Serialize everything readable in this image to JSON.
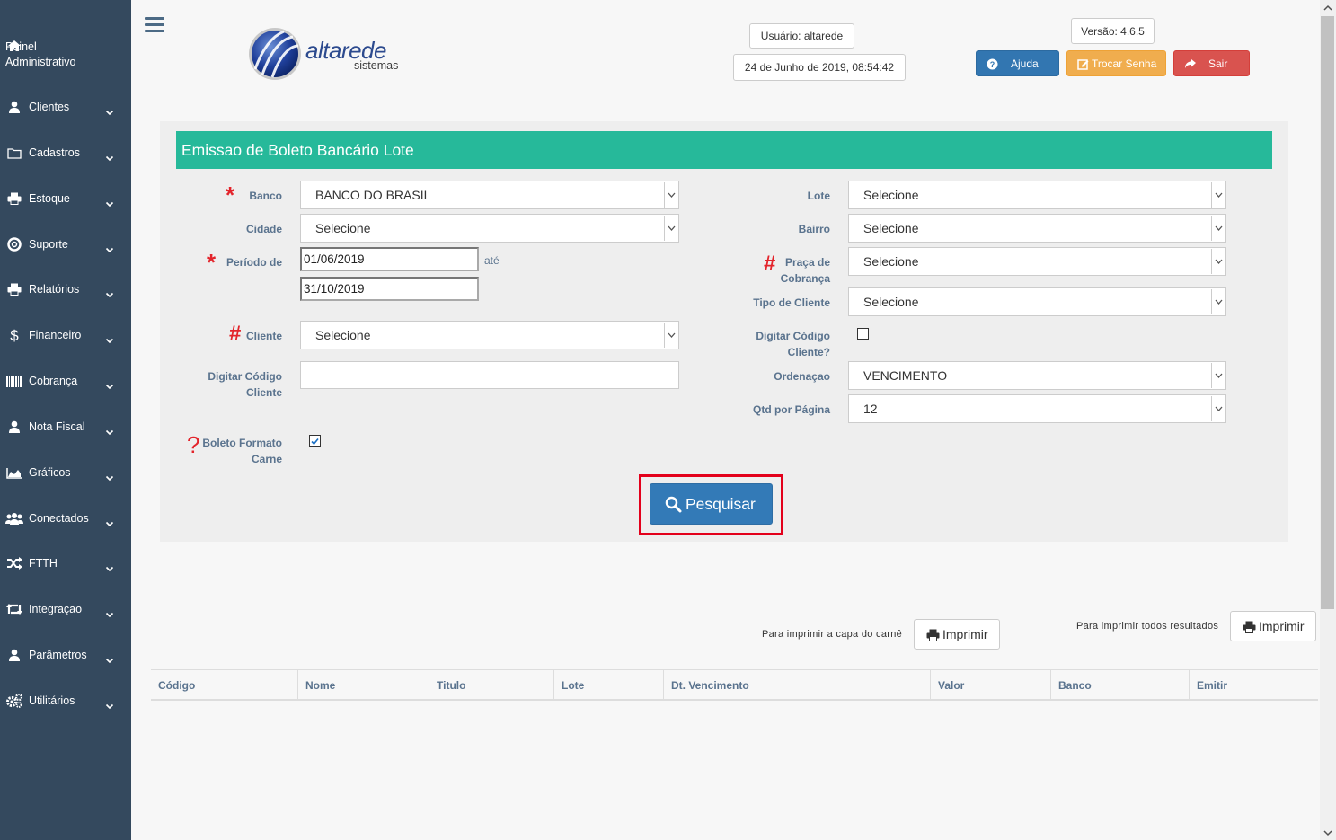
{
  "sidebar": {
    "items": [
      {
        "label": "Painel\nAdministrativo",
        "icon": "home-icon"
      },
      {
        "label": "Clientes",
        "icon": "user-icon"
      },
      {
        "label": "Cadastros",
        "icon": "folder-icon"
      },
      {
        "label": "Estoque",
        "icon": "print-icon"
      },
      {
        "label": "Suporte",
        "icon": "lifebuoy-icon"
      },
      {
        "label": "Relatórios",
        "icon": "print-icon"
      },
      {
        "label": "Financeiro",
        "icon": "dollar-icon"
      },
      {
        "label": "Cobrança",
        "icon": "barcode-icon"
      },
      {
        "label": "Nota Fiscal",
        "icon": "user-icon"
      },
      {
        "label": "Gráficos",
        "icon": "area-chart-icon"
      },
      {
        "label": "Conectados",
        "icon": "users-icon"
      },
      {
        "label": "FTTH",
        "icon": "random-icon"
      },
      {
        "label": "Integraçao",
        "icon": "retweet-icon"
      },
      {
        "label": "Parâmetros",
        "icon": "user-icon"
      },
      {
        "label": "Utilitários",
        "icon": "cogs-icon"
      }
    ]
  },
  "header": {
    "logo_text": "altarede",
    "logo_sub": "sistemas",
    "user": "Usuário: altarede",
    "datetime": "24 de Junho de 2019, 08:54:42",
    "version": "Versão: 4.6.5",
    "help_label": "Ajuda",
    "change_password_label": "Trocar Senha",
    "exit_label": "Sair"
  },
  "colors": {
    "sidebar_bg": "#34495e",
    "panel_title_bg": "#26b99a",
    "primary": "#337ab7",
    "warning": "#f0ad4e",
    "danger": "#d9534f",
    "required": "#e3242b",
    "label": "#5a738e"
  },
  "form": {
    "title": "Emissao de Boleto Bancário Lote",
    "banco": {
      "label": "Banco",
      "value": "BANCO DO BRASIL"
    },
    "cidade": {
      "label": "Cidade",
      "value": "Selecione"
    },
    "periodo": {
      "label": "Período de",
      "start": "01/06/2019",
      "separator": "até",
      "end": "31/10/2019"
    },
    "cliente": {
      "label": "Cliente",
      "value": "Selecione"
    },
    "digitar_codigo": {
      "label_line1": "Digitar Código",
      "label_line2": "Cliente",
      "value": ""
    },
    "boleto_carne": {
      "label_line1": "Boleto Formato",
      "label_line2": "Carne",
      "checked": true
    },
    "lote": {
      "label": "Lote",
      "value": "Selecione"
    },
    "bairro": {
      "label": "Bairro",
      "value": "Selecione"
    },
    "praca": {
      "label_line1": "Praça de",
      "label_line2": "Cobrança",
      "value": "Selecione"
    },
    "tipo_cliente": {
      "label": "Tipo de Cliente",
      "value": "Selecione"
    },
    "digitar_codigo_q": {
      "label_line1": "Digitar Código",
      "label_line2": "Cliente?",
      "checked": false
    },
    "ordenacao": {
      "label": "Ordenaçao",
      "value": "VENCIMENTO"
    },
    "qtd_pagina": {
      "label": "Qtd por Página",
      "value": "12"
    },
    "search_label": "Pesquisar"
  },
  "print": {
    "cover_note": "Para imprimir a capa do carnê",
    "all_note": "Para imprimir todos resultados",
    "print_label": "Imprimir"
  },
  "table": {
    "columns": [
      "Código",
      "Nome",
      "Titulo",
      "Lote",
      "Dt. Vencimento",
      "Valor",
      "Banco",
      "Emitir"
    ]
  }
}
